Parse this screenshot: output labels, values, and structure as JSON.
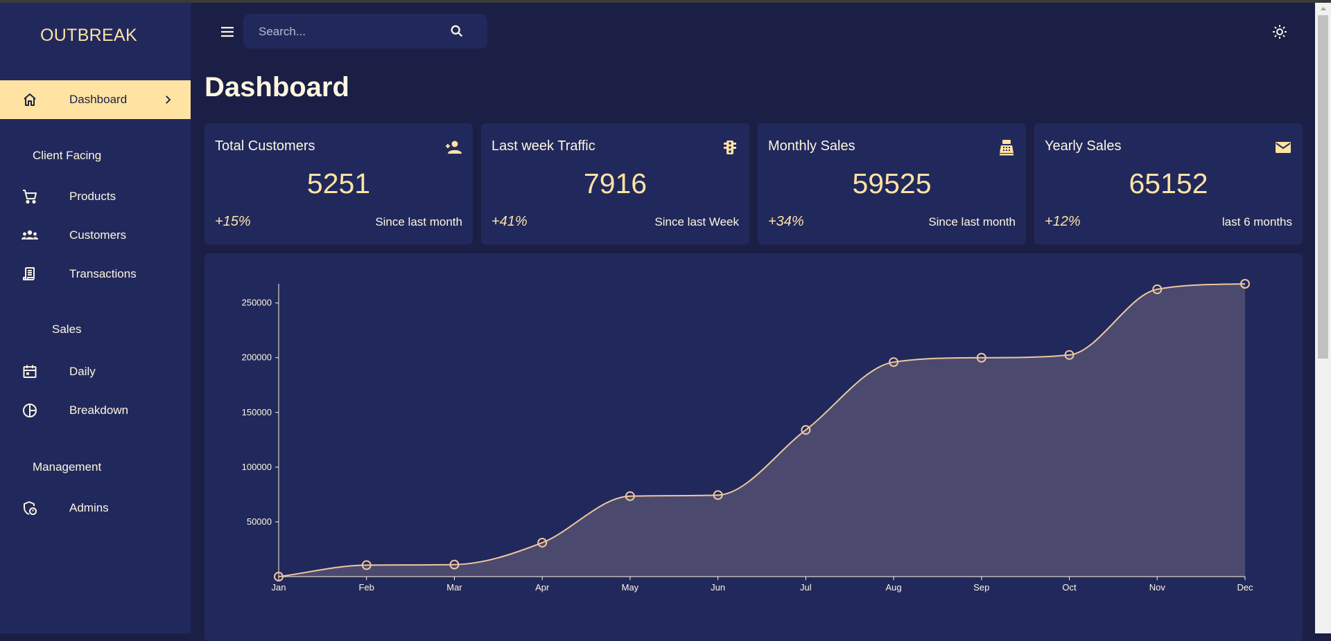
{
  "app": {
    "brand": "OUTBREAK"
  },
  "sidebar": {
    "items": [
      {
        "label": "Dashboard",
        "icon": "home-icon",
        "active": true
      },
      {
        "label": "Products",
        "icon": "cart-icon"
      },
      {
        "label": "Customers",
        "icon": "groups-icon"
      },
      {
        "label": "Transactions",
        "icon": "receipt-icon"
      },
      {
        "label": "Daily",
        "icon": "calendar-icon"
      },
      {
        "label": "Breakdown",
        "icon": "pie-chart-icon"
      },
      {
        "label": "Admins",
        "icon": "admin-shield-icon"
      }
    ],
    "sections": [
      "Client Facing",
      "Sales",
      "Management"
    ]
  },
  "topbar": {
    "search_placeholder": "Search...",
    "search_value": ""
  },
  "page": {
    "title": "Dashboard"
  },
  "stats": [
    {
      "title": "Total Customers",
      "value": "5251",
      "change": "+15%",
      "desc": "Since last month",
      "icon": "person-add-icon"
    },
    {
      "title": "Last week Traffic",
      "value": "7916",
      "change": "+41%",
      "desc": "Since last Week",
      "icon": "traffic-icon"
    },
    {
      "title": "Monthly Sales",
      "value": "59525",
      "change": "+34%",
      "desc": "Since last month",
      "icon": "point-of-sale-icon"
    },
    {
      "title": "Yearly Sales",
      "value": "65152",
      "change": "+12%",
      "desc": "last 6 months",
      "icon": "email-icon"
    }
  ],
  "colors": {
    "bg": "#1b1f45",
    "panel": "#21295c",
    "accent": "#ffe3a3",
    "line": "#f0c7a0",
    "area": "#4b4a6e",
    "text": "#fff6e0"
  },
  "chart_data": {
    "type": "area",
    "title": "",
    "xlabel": "",
    "ylabel": "",
    "categories": [
      "Jan",
      "Feb",
      "Mar",
      "Apr",
      "May",
      "Jun",
      "Jul",
      "Aug",
      "Sep",
      "Oct",
      "Nov",
      "Dec"
    ],
    "series": [
      {
        "values": [
          0,
          10500,
          11000,
          31000,
          73500,
          74500,
          134000,
          196000,
          200000,
          202500,
          262500,
          267500
        ]
      }
    ],
    "yticks": [
      50000,
      100000,
      150000,
      200000,
      250000
    ],
    "ylim": [
      0,
      267500
    ],
    "grid": false,
    "legend": "none"
  }
}
